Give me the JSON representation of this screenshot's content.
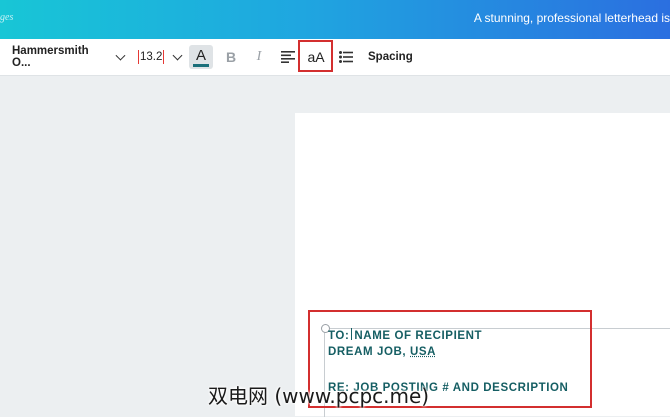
{
  "banner": {
    "breadcrumb": "ges",
    "title": "A stunning, professional letterhead is"
  },
  "toolbar": {
    "font_name": "Hammersmith O...",
    "font_size": "13.2",
    "text_color_letter": "A",
    "text_color": "#1b6f7a",
    "bold_label": "B",
    "italic_label": "I",
    "case_label": "aA",
    "spacing_label": "Spacing"
  },
  "document": {
    "lines": [
      {
        "prefix": "TO:",
        "text": "NAME OF RECIPIENT"
      },
      {
        "prefix": "DREAM JOB, ",
        "text": "USA"
      },
      {
        "prefix": "RE: ",
        "text": "JOB POSTING # AND DESCRIPTION"
      }
    ]
  },
  "watermark": "双电网 (www.pcpc.me)",
  "colors": {
    "annotation": "#d32f2f",
    "text": "#155e63",
    "banner_start": "#18c6d6",
    "banner_end": "#2b6fe0"
  }
}
